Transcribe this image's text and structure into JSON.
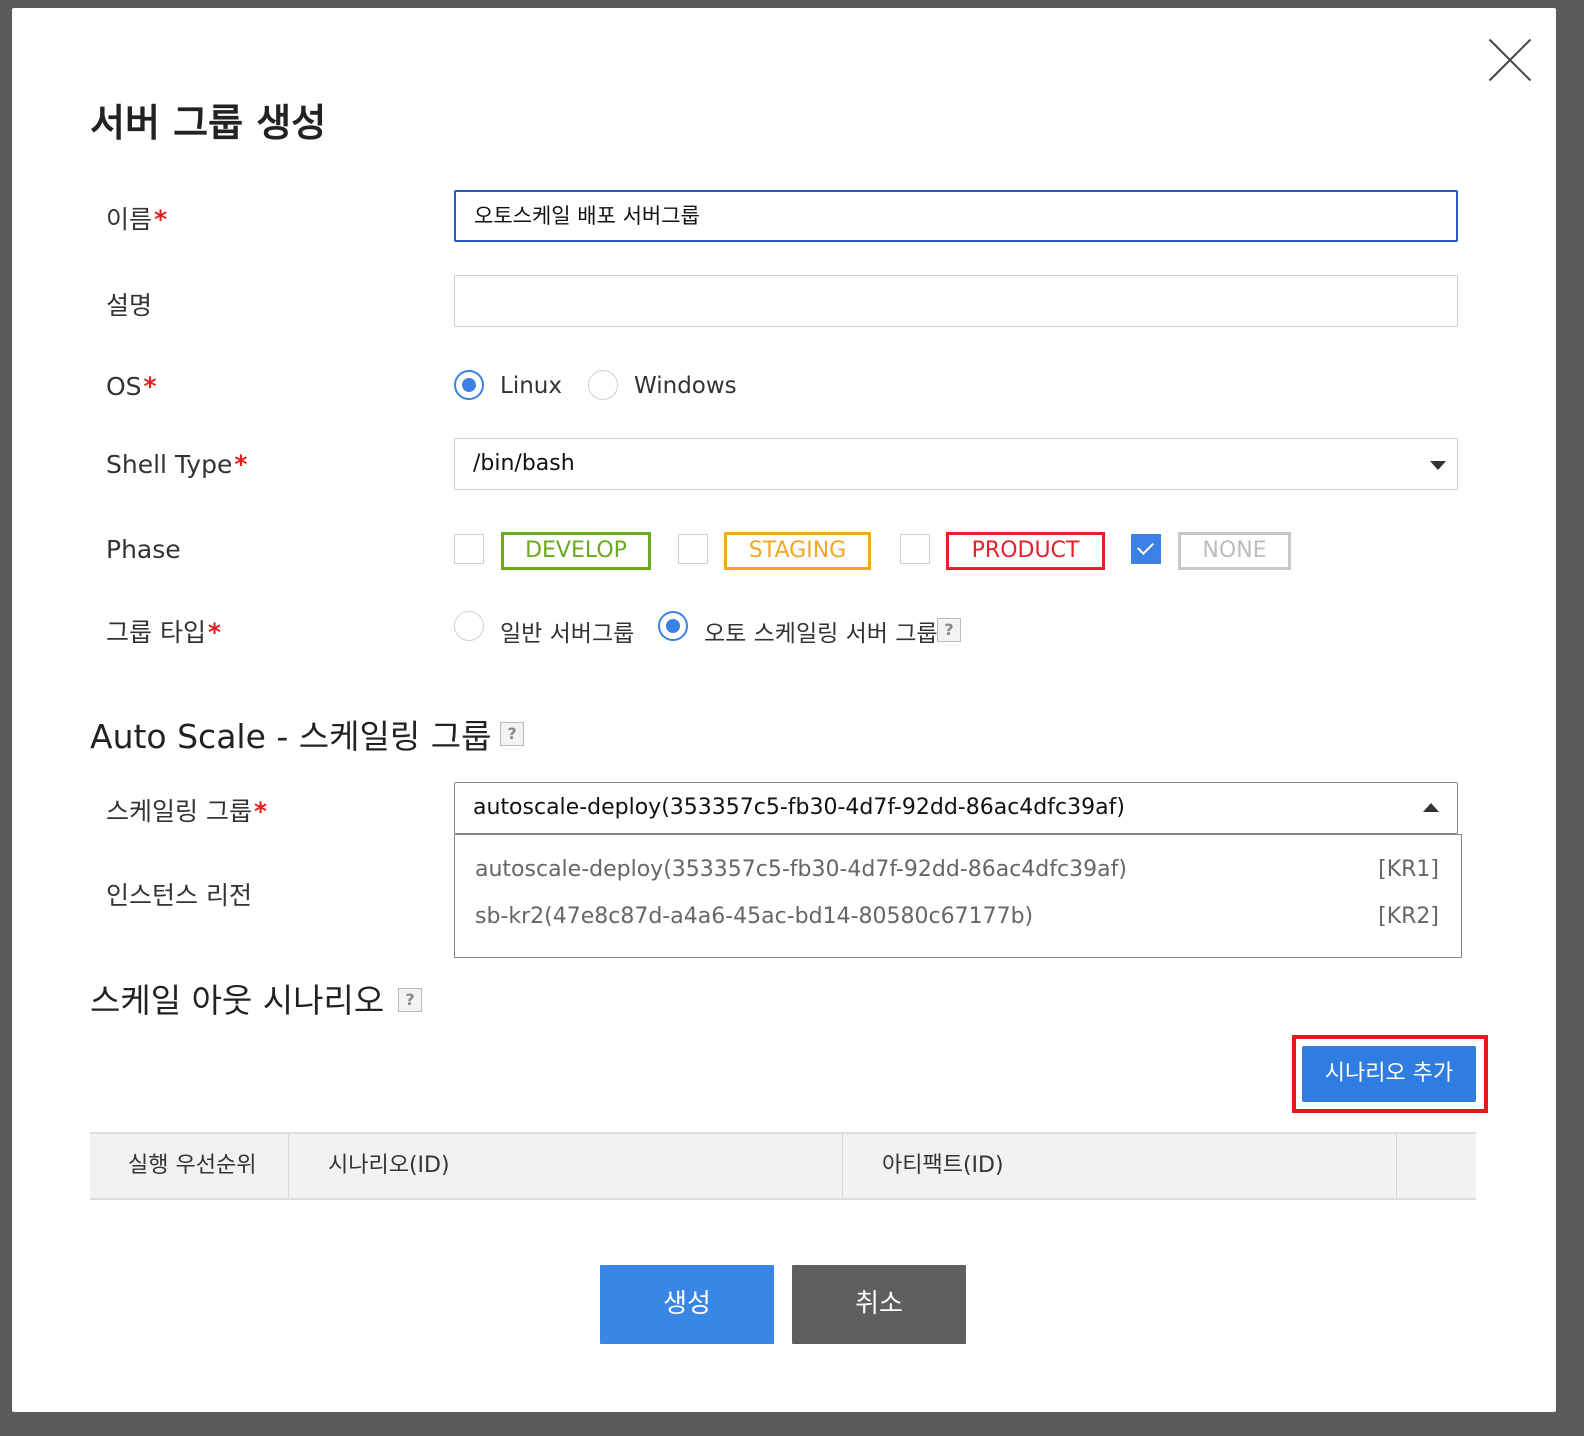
{
  "dialog": {
    "title": "서버 그룹 생성",
    "close_icon": "close-icon"
  },
  "form": {
    "name": {
      "label": "이름",
      "required_mark": "*",
      "value": "오토스케일 배포 서버그룹"
    },
    "description": {
      "label": "설명",
      "value": ""
    },
    "os": {
      "label": "OS",
      "required_mark": "*",
      "options": [
        {
          "label": "Linux",
          "selected": true
        },
        {
          "label": "Windows",
          "selected": false
        }
      ]
    },
    "shell_type": {
      "label": "Shell Type",
      "required_mark": "*",
      "value": "/bin/bash"
    },
    "phase": {
      "label": "Phase",
      "options": [
        {
          "label": "DEVELOP",
          "checked": false,
          "color": "#6aaa1f"
        },
        {
          "label": "STAGING",
          "checked": false,
          "color": "#f5a623"
        },
        {
          "label": "PRODUCT",
          "checked": false,
          "color": "#e8202a"
        },
        {
          "label": "NONE",
          "checked": true,
          "color": "#bdbdbd"
        }
      ]
    },
    "group_type": {
      "label": "그룹 타입",
      "required_mark": "*",
      "options": [
        {
          "label": "일반 서버그룹",
          "selected": false
        },
        {
          "label": "오토 스케일링 서버 그룹",
          "selected": true
        }
      ],
      "help": "?"
    }
  },
  "autoscale": {
    "section_title": "Auto Scale - 스케일링 그룹",
    "help": "?",
    "scaling_group": {
      "label": "스케일링 그룹",
      "required_mark": "*",
      "value": "autoscale-deploy(353357c5-fb30-4d7f-92dd-86ac4dfc39af)",
      "options": [
        {
          "name": "autoscale-deploy(353357c5-fb30-4d7f-92dd-86ac4dfc39af)",
          "region": "[KR1]"
        },
        {
          "name": "sb-kr2(47e8c87d-a4a6-45ac-bd14-80580c67177b)",
          "region": "[KR2]"
        }
      ]
    },
    "instance_region": {
      "label": "인스턴스 리전"
    }
  },
  "scale_out": {
    "section_title": "스케일 아웃 시나리오",
    "help": "?",
    "add_button": "시나리오 추가",
    "table_headers": [
      "실행 우선순위",
      "시나리오(ID)",
      "아티팩트(ID)",
      ""
    ]
  },
  "actions": {
    "create": "생성",
    "cancel": "취소"
  },
  "colors": {
    "primary": "#3a86e6",
    "highlight": "#e21b1b",
    "required": "#e02020"
  }
}
